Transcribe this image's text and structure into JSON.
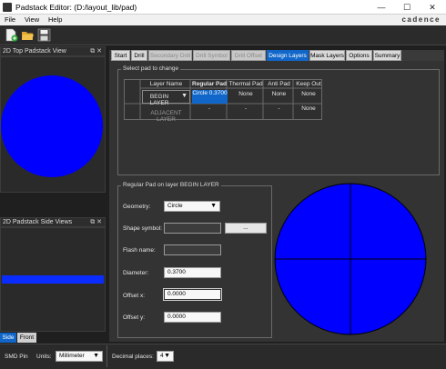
{
  "window": {
    "title": "Padstack Editor:  (D:/layout_lib/pad)",
    "minimize": "—",
    "maximize": "☐",
    "close": "✕"
  },
  "menu": {
    "items": [
      "File",
      "View",
      "Help"
    ],
    "brand": "cadence"
  },
  "toolbar": {
    "icons": [
      "new-icon",
      "open-folder-icon",
      "save-icon"
    ]
  },
  "top_view": {
    "title": "2D Top Padstack View",
    "buttons": "⧉ ✕",
    "pad_color": "#0000ff"
  },
  "side_view": {
    "title": "2D Padstack Side Views",
    "buttons": "⧉ ✕",
    "bar_color": "#0a2cff"
  },
  "side_tabs": {
    "side": "Side",
    "front": "Front"
  },
  "tabs": [
    {
      "label": "Start",
      "state": "normal"
    },
    {
      "label": "Drill",
      "state": "normal"
    },
    {
      "label": "Secondary Drill",
      "state": "disabled"
    },
    {
      "label": "Drill Symbol",
      "state": "disabled"
    },
    {
      "label": "Drill Offset",
      "state": "disabled"
    },
    {
      "label": "Design Layers",
      "state": "active"
    },
    {
      "label": "Mask Layers",
      "state": "normal"
    },
    {
      "label": "Options",
      "state": "normal"
    },
    {
      "label": "Summary",
      "state": "normal"
    }
  ],
  "select_pad": {
    "group_title": "Select pad to change",
    "headers": [
      "Layer Name",
      "Regular Pad",
      "Thermal Pad",
      "Anti Pad",
      "Keep Out"
    ],
    "rows": [
      {
        "layer": "BEGIN LAYER",
        "regular": "Circle 0.3700",
        "thermal": "None",
        "anti": "None",
        "keepout": "None"
      },
      {
        "layer": "ADJACENT LAYER",
        "regular": "-",
        "thermal": "-",
        "anti": "-",
        "keepout": "None"
      }
    ]
  },
  "regular_pad": {
    "group_title": "Regular Pad on layer BEGIN LAYER",
    "geometry_label": "Geometry:",
    "geometry_value": "Circle",
    "shape_symbol_label": "Shape symbol:",
    "shape_symbol_value": "",
    "browse_label": "...",
    "flash_name_label": "Flash name:",
    "flash_name_value": "",
    "diameter_label": "Diameter:",
    "diameter_value": "0.3700",
    "offset_x_label": "Offset x:",
    "offset_x_value": "0.0000",
    "offset_y_label": "Offset y:",
    "offset_y_value": "0.0000"
  },
  "preview": {
    "pad_color": "#0000ff",
    "crosshair_color": "#000000"
  },
  "status": {
    "smd_pin": "SMD Pin",
    "units_label": "Units:",
    "units_value": "Millimeter",
    "decimal_label": "Decimal places:",
    "decimal_value": "4"
  }
}
